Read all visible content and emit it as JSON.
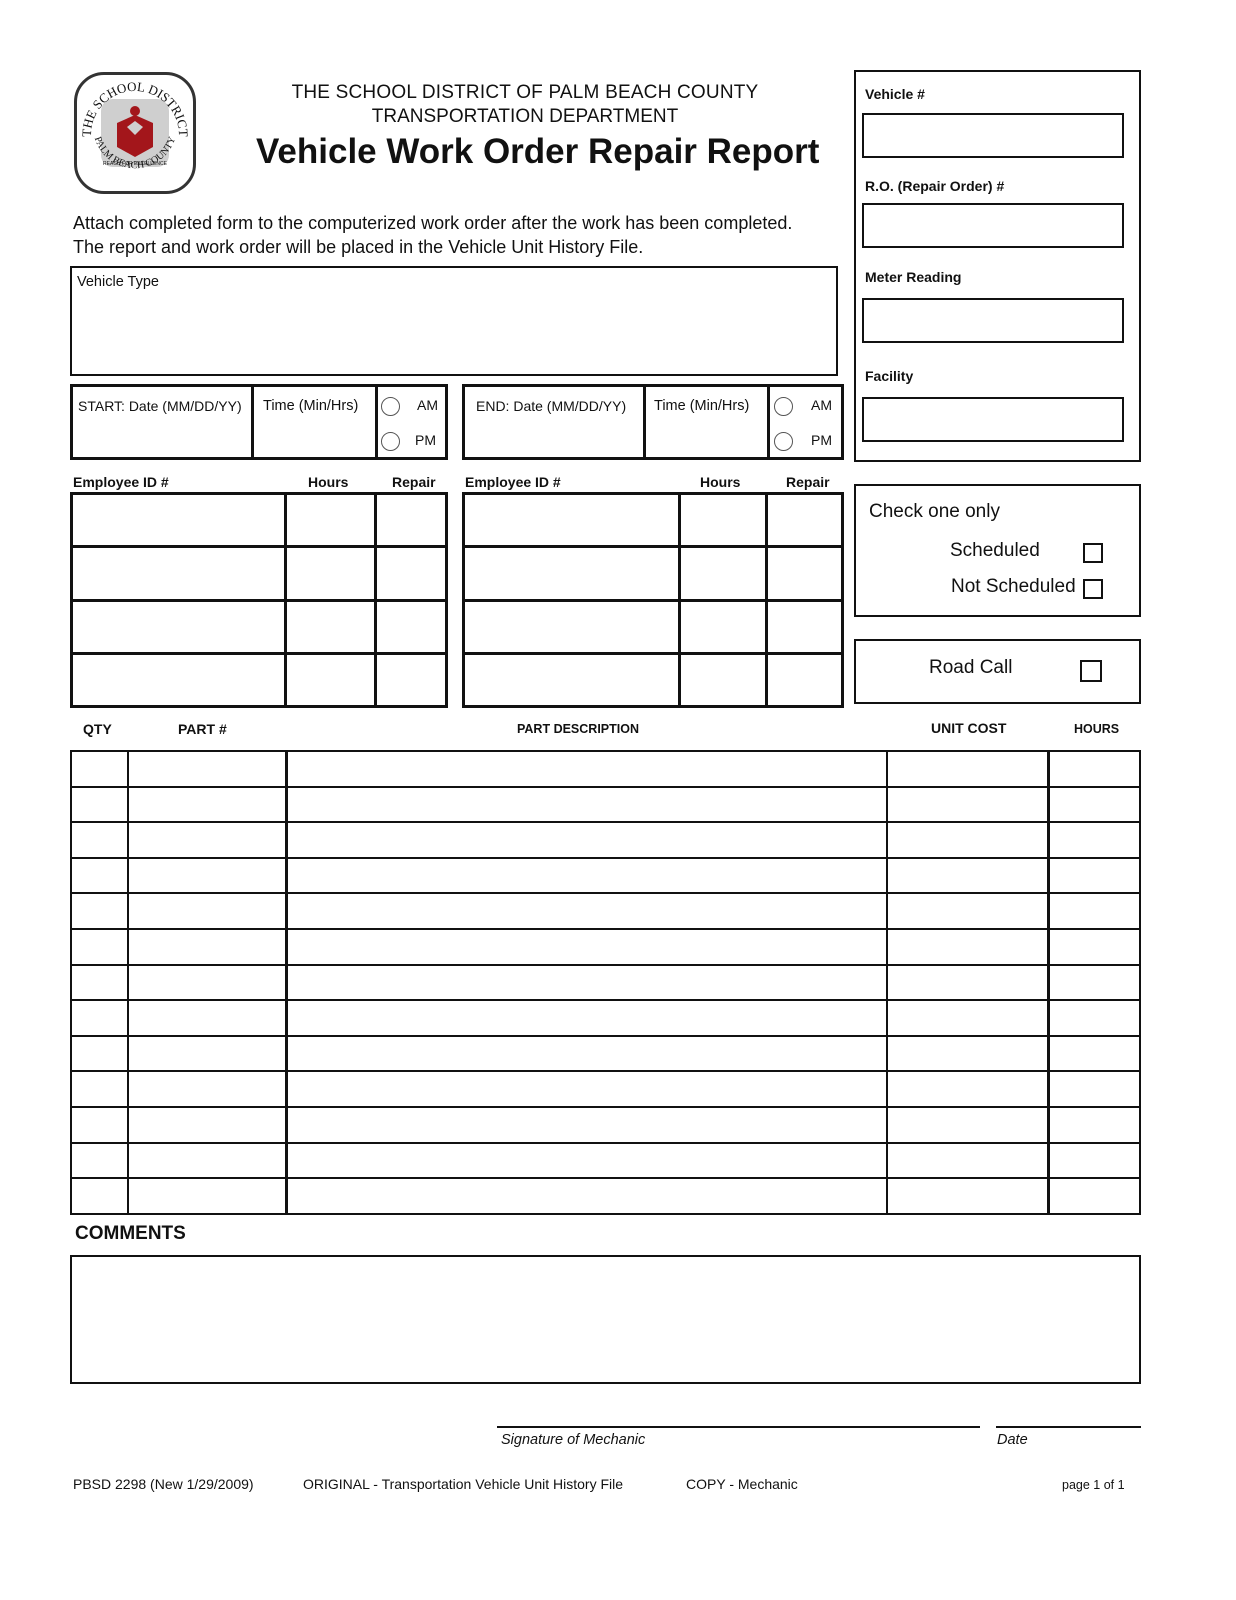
{
  "header": {
    "org_line1": "THE SCHOOL DISTRICT OF PALM BEACH COUNTY",
    "org_line2": "TRANSPORTATION DEPARTMENT",
    "title": "Vehicle Work Order Repair Report",
    "logo": {
      "top_text": "THE SCHOOL DISTRICT",
      "bottom_text": "PALM BEACH COUNTY",
      "motto": "REACH FOR EXCELLENCE",
      "accent": "#a3161b"
    }
  },
  "instructions": {
    "line1": "Attach completed form to the computerized work order after the work has been completed.",
    "line2": "The report and work order will be placed in the Vehicle Unit History File."
  },
  "vehicle_type": {
    "label": "Vehicle Type",
    "value": ""
  },
  "right_panel": {
    "vehicle_no": {
      "label": "Vehicle #",
      "value": ""
    },
    "repair_order_no": {
      "label": "R.O. (Repair Order) #",
      "value": ""
    },
    "meter_reading": {
      "label": "Meter Reading",
      "value": ""
    },
    "facility": {
      "label": "Facility",
      "value": ""
    }
  },
  "start": {
    "date_label": "START: Date (MM/DD/YY)",
    "time_label": "Time (Min/Hrs)",
    "am": "AM",
    "pm": "PM"
  },
  "end": {
    "date_label": "END: Date (MM/DD/YY)",
    "time_label": "Time (Min/Hrs)",
    "am": "AM",
    "pm": "PM"
  },
  "employee_tables": {
    "headers": [
      "Employee ID #",
      "Hours",
      "Repair"
    ],
    "rows_per_table": 4
  },
  "check_one": {
    "title": "Check one only",
    "options": [
      "Scheduled",
      "Not Scheduled"
    ]
  },
  "road_call": {
    "label": "Road Call"
  },
  "parts_table": {
    "headers": {
      "qty": "QTY",
      "part": "PART #",
      "description": "PART DESCRIPTION",
      "unit_cost": "UNIT COST",
      "hours": "HOURS"
    },
    "row_count": 13
  },
  "comments": {
    "label": "COMMENTS",
    "value": ""
  },
  "signature": {
    "mechanic_label": "Signature of Mechanic",
    "date_label": "Date"
  },
  "footer": {
    "form_id": "PBSD 2298 (New 1/29/2009)",
    "original": "ORIGINAL - Transportation Vehicle Unit History File",
    "copy": "COPY - Mechanic",
    "page": "page 1 of 1"
  }
}
